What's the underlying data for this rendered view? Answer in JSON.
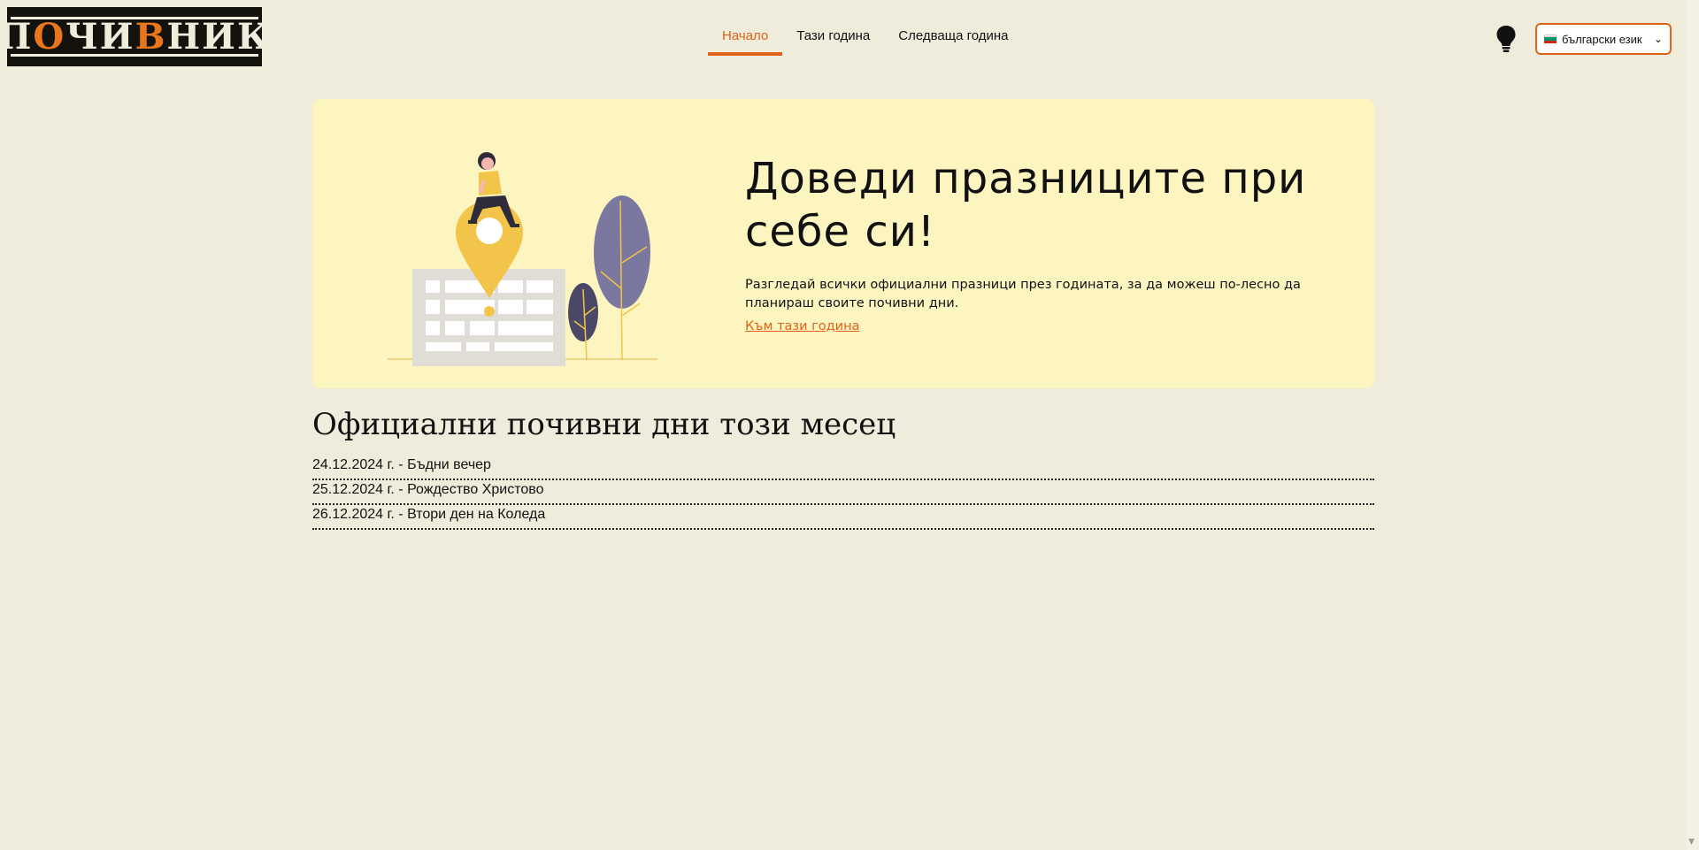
{
  "logo": {
    "text_before": "П",
    "accent_o": "О",
    "text_mid": "ЧИ",
    "accent_v": "В",
    "text_after": "НИК",
    "alt": "Почивник"
  },
  "nav": {
    "items": [
      {
        "label": "Начало",
        "active": true
      },
      {
        "label": "Тази година",
        "active": false
      },
      {
        "label": "Следваща година",
        "active": false
      }
    ]
  },
  "header": {
    "theme_icon": "lightbulb-icon",
    "language_select": {
      "value": "български език",
      "flag": "bulgaria-flag-icon"
    }
  },
  "hero": {
    "title": "Доведи празниците при себе си!",
    "description": "Разгледай всички официални празници през годината, за да можеш по-лесно да планираш своите почивни дни.",
    "link": "Към тази година"
  },
  "month_section": {
    "title": "Официални почивни дни този месец",
    "items": [
      "24.12.2024 г. - Бъдни вечер",
      "25.12.2024 г. - Рождество Христово",
      "26.12.2024 г. - Втори ден на Коледа"
    ]
  },
  "colors": {
    "background": "#f0ecdb",
    "accent": "#e0611a",
    "hero_background": "#fdf5bf",
    "illustration_yellow": "#f2c449",
    "illustration_purple": "#7b789f"
  }
}
